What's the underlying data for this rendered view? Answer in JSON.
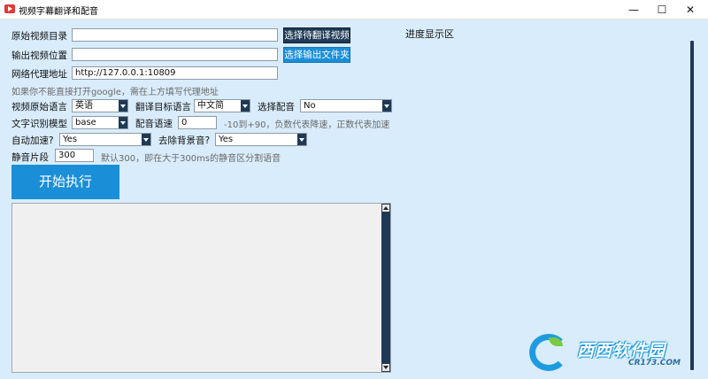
{
  "window": {
    "title": "视频字幕翻译和配音",
    "minimize": "—",
    "maximize": "☐",
    "close": "✕"
  },
  "form": {
    "source_dir_label": "原始视频目录",
    "source_dir_value": "",
    "select_video_button": "选择待翻译视频",
    "output_dir_label": "输出视频位置",
    "output_dir_value": "",
    "select_output_button": "选择输出文件夹",
    "proxy_label": "网络代理地址",
    "proxy_value": "http://127.0.0.1:10809",
    "proxy_hint": "如果你不能直接打开google，需在上方填写代理地址",
    "source_lang_label": "视频原始语言",
    "source_lang_value": "英语",
    "target_lang_label": "翻译目标语言",
    "target_lang_value": "中文简",
    "voice_label": "选择配音",
    "voice_value": "No",
    "asr_model_label": "文字识别模型",
    "asr_model_value": "base",
    "voice_rate_label": "配音语速",
    "voice_rate_value": "0",
    "voice_rate_hint": "-10到+90，负数代表降速，正数代表加速",
    "auto_speed_label": "自动加速?",
    "auto_speed_value": "Yes",
    "remove_bg_label": "去除背景音?",
    "remove_bg_value": "Yes",
    "silence_label": "静音片段",
    "silence_value": "300",
    "silence_hint": "默认300，即在大于300ms的静音区分割语音",
    "start_button": "开始执行"
  },
  "log": {
    "content": ""
  },
  "progress": {
    "title": "进度显示区"
  },
  "watermark": {
    "brand": "西西软件园",
    "url": "CR173.COM"
  }
}
